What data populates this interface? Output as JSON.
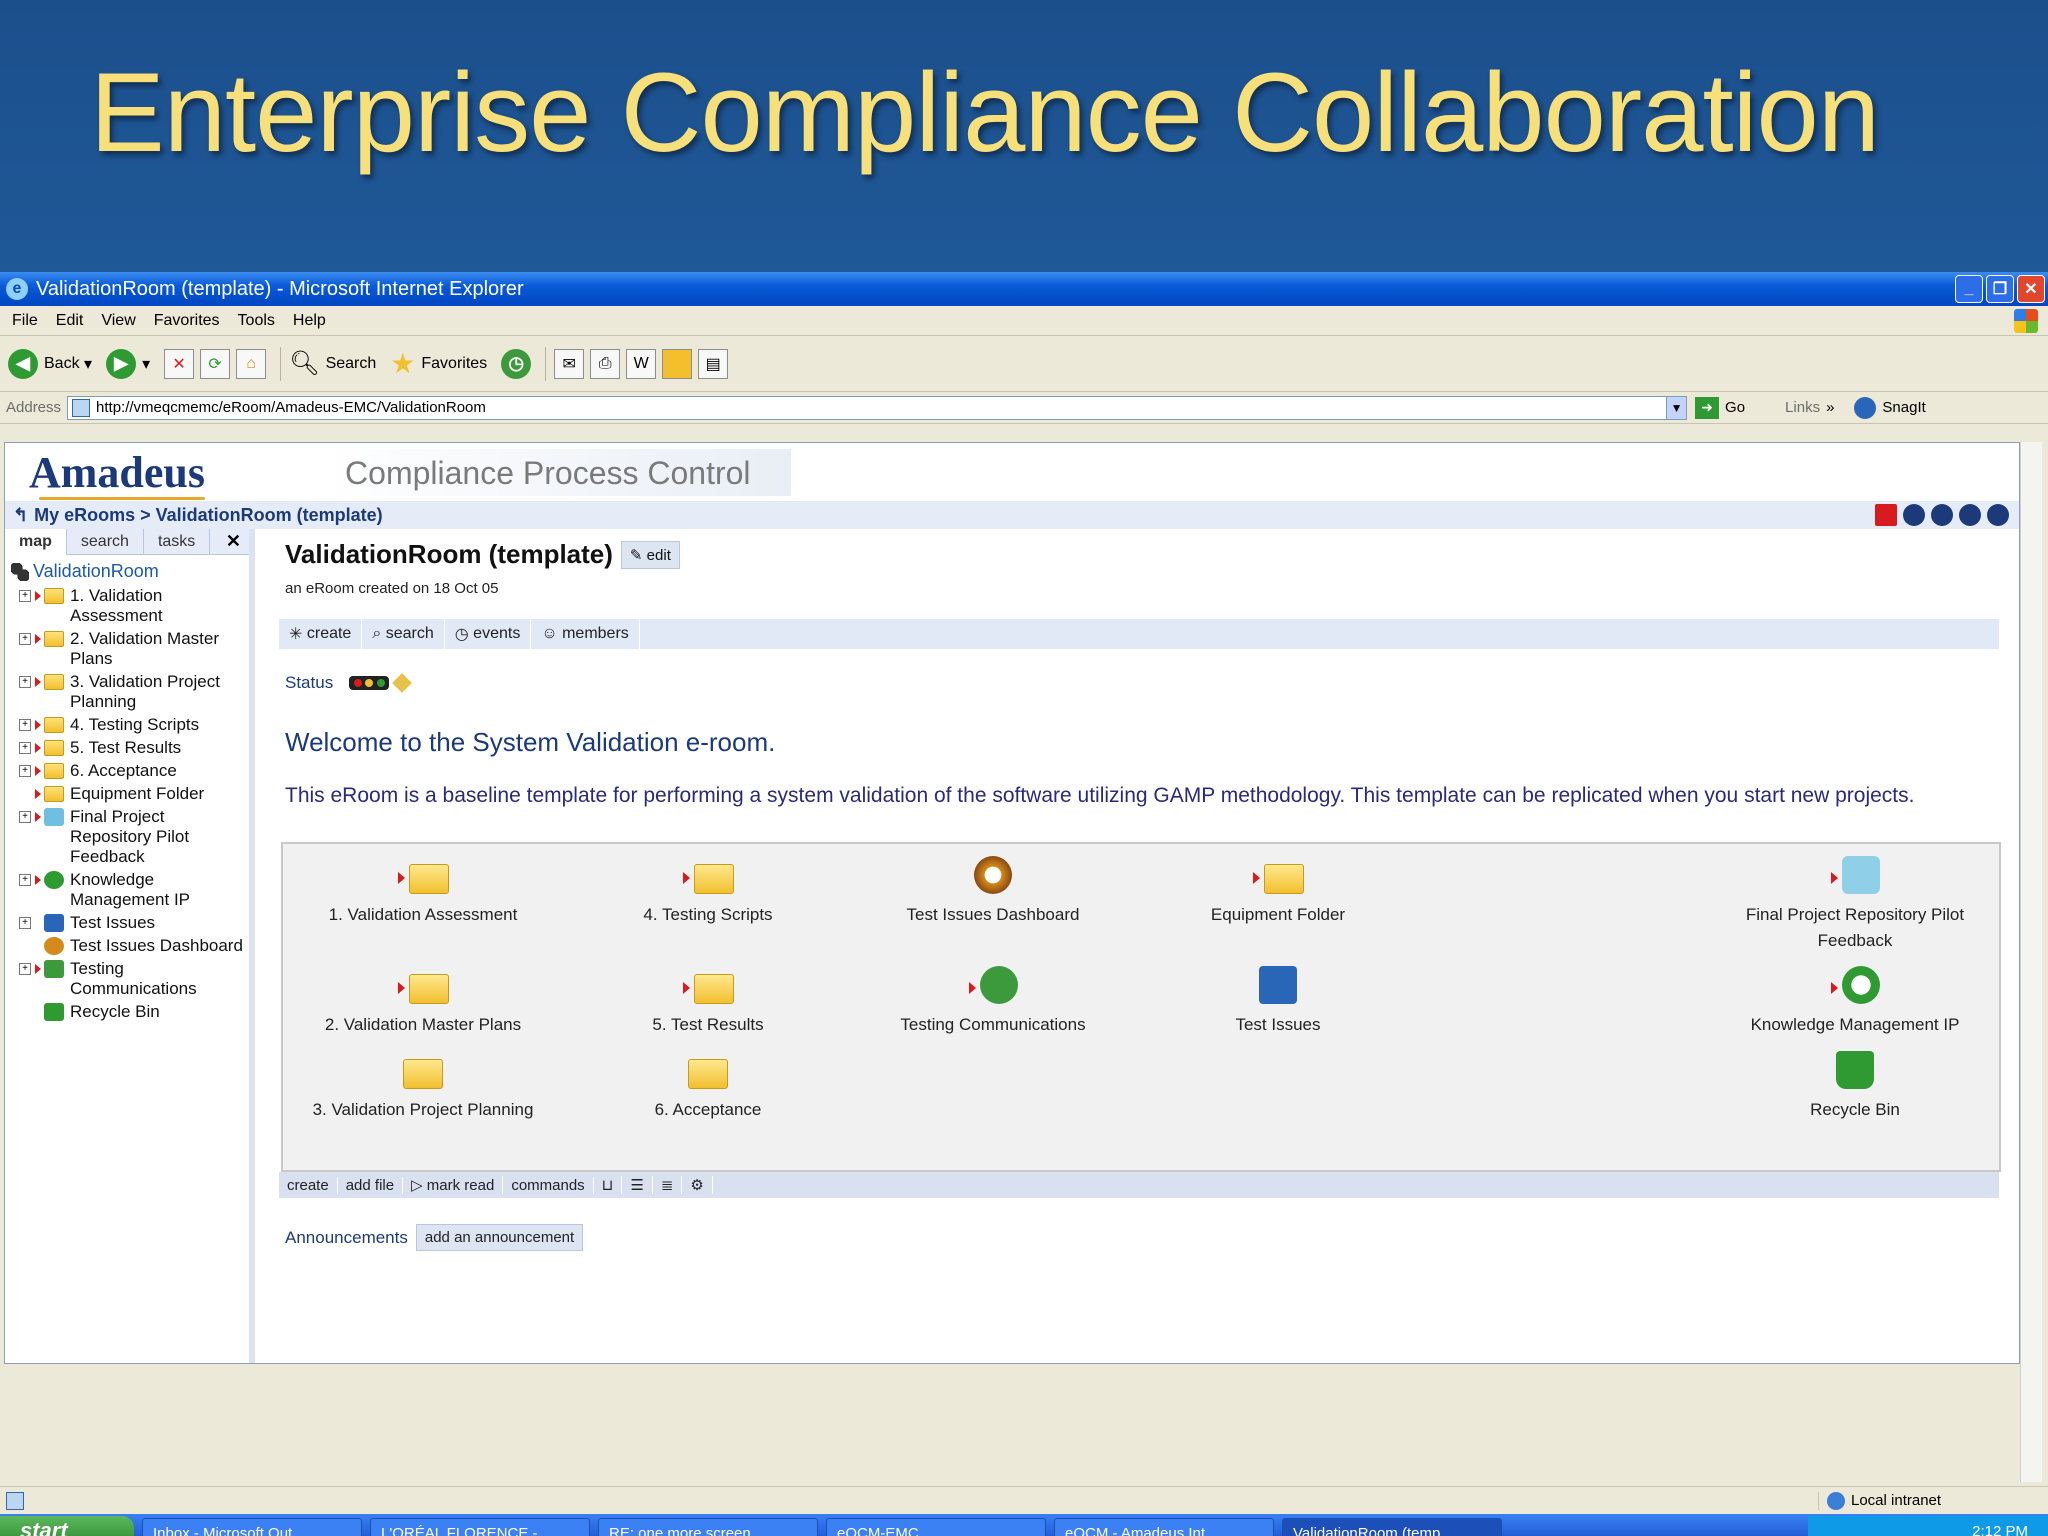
{
  "slide": {
    "title": "Enterprise Compliance Collaboration"
  },
  "window": {
    "title": "ValidationRoom (template) - Microsoft Internet Explorer"
  },
  "menu": [
    "File",
    "Edit",
    "View",
    "Favorites",
    "Tools",
    "Help"
  ],
  "toolbar": {
    "back": "Back",
    "search": "Search",
    "favorites": "Favorites"
  },
  "address": {
    "label": "Address",
    "url": "http://vmeqcmemc/eRoom/Amadeus-EMC/ValidationRoom",
    "go": "Go",
    "links": "Links",
    "snagit": "SnagIt"
  },
  "header": {
    "logo": "Amadeus",
    "product": "Compliance Process Control"
  },
  "breadcrumb": "My eRooms > ValidationRoom (template)",
  "sidebar": {
    "tabs": [
      "map",
      "search",
      "tasks"
    ],
    "root": "ValidationRoom",
    "items": [
      {
        "label": "1. Validation Assessment"
      },
      {
        "label": "2. Validation Master Plans"
      },
      {
        "label": "3. Validation Project Planning"
      },
      {
        "label": "4. Testing Scripts"
      },
      {
        "label": "5. Test Results"
      },
      {
        "label": "6. Acceptance"
      },
      {
        "label": "Equipment Folder"
      },
      {
        "label": "Final Project Repository Pilot Feedback"
      },
      {
        "label": "Knowledge Management IP"
      },
      {
        "label": "Test Issues"
      },
      {
        "label": "Test Issues Dashboard"
      },
      {
        "label": "Testing Communications"
      },
      {
        "label": "Recycle Bin"
      }
    ]
  },
  "main": {
    "room_title": "ValidationRoom (template)",
    "edit": "edit",
    "created": "an eRoom created on 18 Oct 05",
    "actions": [
      "create",
      "search",
      "events",
      "members"
    ],
    "status_label": "Status",
    "welcome": "Welcome to the System Validation e-room.",
    "description": "This eRoom is a baseline template for performing a system validation of the software utilizing GAMP methodology.  This template can be replicated when you start new projects.",
    "grid": [
      {
        "label": "1. Validation Assessment",
        "icon": "folder-icon"
      },
      {
        "label": "4. Testing Scripts",
        "icon": "folder-icon"
      },
      {
        "label": "Test Issues Dashboard",
        "icon": "dashboard-icon"
      },
      {
        "label": "Equipment Folder",
        "icon": "folder-icon"
      },
      {
        "label": "Final Project Repository Pilot Feedback",
        "icon": "feedback-icon"
      },
      {
        "label": "2. Validation Master Plans",
        "icon": "folder-icon"
      },
      {
        "label": "5. Test Results",
        "icon": "folder-icon"
      },
      {
        "label": "Testing Communications",
        "icon": "discussion-icon"
      },
      {
        "label": "Test Issues",
        "icon": "database-icon"
      },
      {
        "label": "Knowledge Management IP",
        "icon": "recycle-arrows-icon"
      },
      {
        "label": "3. Validation Project Planning",
        "icon": "folder-icon"
      },
      {
        "label": "6. Acceptance",
        "icon": "folder-icon"
      },
      {
        "label": "Recycle Bin",
        "icon": "recycle-bin-icon"
      }
    ],
    "bottom_actions": [
      "create",
      "add file",
      "mark read",
      "commands"
    ],
    "announcements_label": "Announcements",
    "add_announcement": "add an announcement"
  },
  "statusbar": {
    "zone": "Local intranet"
  },
  "taskbar": {
    "start": "start",
    "tasks": [
      "Inbox - Microsoft Out...",
      "L'ORÉAL FLORENCE -...",
      "RE: one more screen...",
      "eQCM-EMC",
      "eQCM - Amadeus Int...",
      "ValidationRoom (temp..."
    ],
    "clock": "2:12 PM"
  },
  "colors": {
    "title_gold": "#f7e07a",
    "xp_blue": "#0a5ad8",
    "eroom_navy": "#1c3a7a"
  }
}
